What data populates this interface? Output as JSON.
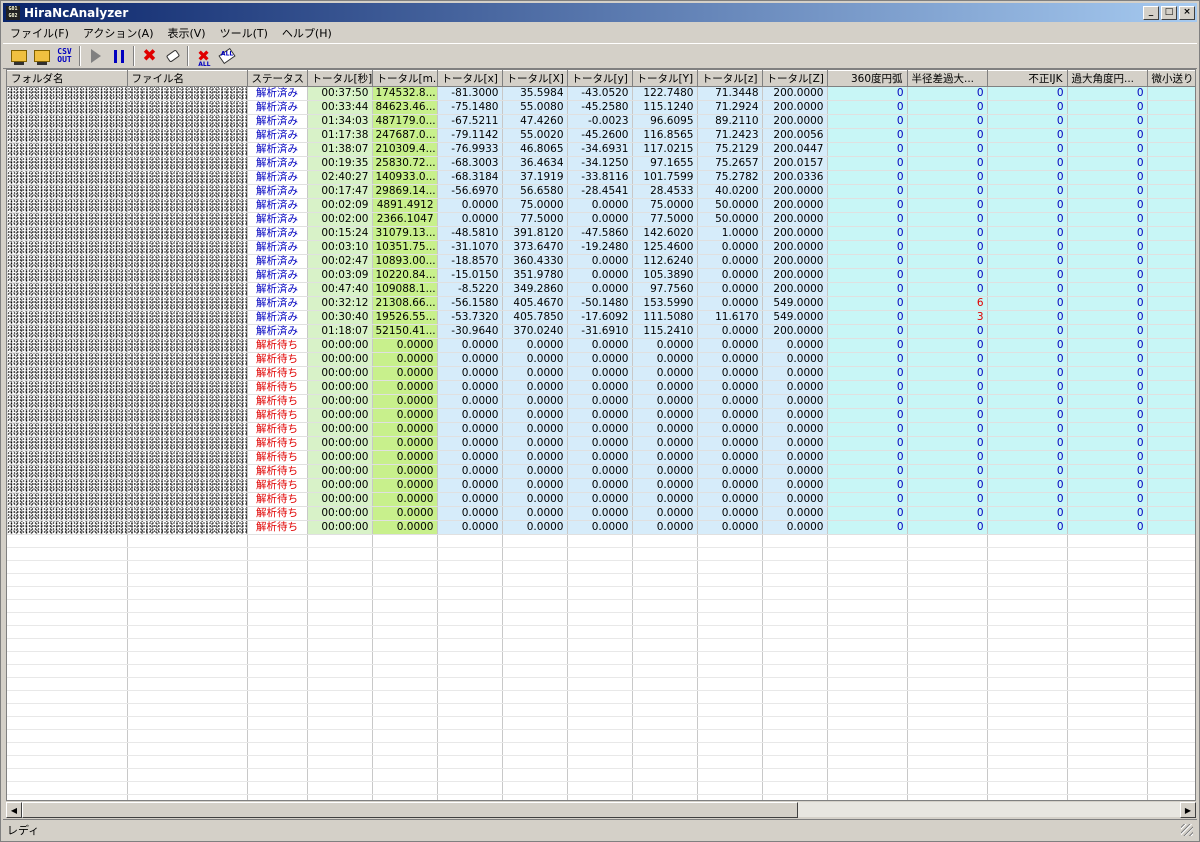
{
  "window": {
    "title": "HiraNcAnalyzer",
    "app_icon_text": "G01 G02"
  },
  "window_buttons": [
    "_",
    "□",
    "×"
  ],
  "menu": [
    "ファイル(F)",
    "アクション(A)",
    "表示(V)",
    "ツール(T)",
    "ヘルプ(H)"
  ],
  "toolbar": {
    "buttons": [
      "open-file-icon",
      "open-folder-icon",
      "csv-out-icon",
      "play-icon",
      "pause-icon",
      "delete-icon",
      "clear-icon",
      "delete-all-icon",
      "clear-all-icon"
    ],
    "csv_label": "CSV OUT",
    "all_label": "ALL"
  },
  "columns": [
    "フォルダ名",
    "ファイル名",
    "ステータス",
    "トータル[秒]",
    "トータル[m...",
    "トータル[x]",
    "トータル[X]",
    "トータル[y]",
    "トータル[Y]",
    "トータル[z]",
    "トータル[Z]",
    "360度円弧",
    "半径差過大...",
    "不正IJK",
    "過大角度円...",
    "微小送り"
  ],
  "rows": [
    [
      "解析済み",
      "00:37:50",
      "174532.8...",
      "-81.3000",
      "35.5984",
      "-43.0520",
      "122.7480",
      "71.3448",
      "200.0000",
      "0",
      "0",
      "0",
      "0"
    ],
    [
      "解析済み",
      "00:33:44",
      "84623.46...",
      "-75.1480",
      "55.0080",
      "-45.2580",
      "115.1240",
      "71.2924",
      "200.0000",
      "0",
      "0",
      "0",
      "0"
    ],
    [
      "解析済み",
      "01:34:03",
      "487179.0...",
      "-67.5211",
      "47.4260",
      "-0.0023",
      "96.6095",
      "89.2110",
      "200.0000",
      "0",
      "0",
      "0",
      "0"
    ],
    [
      "解析済み",
      "01:17:38",
      "247687.0...",
      "-79.1142",
      "55.0020",
      "-45.2600",
      "116.8565",
      "71.2423",
      "200.0056",
      "0",
      "0",
      "0",
      "0"
    ],
    [
      "解析済み",
      "01:38:07",
      "210309.4...",
      "-76.9933",
      "46.8065",
      "-34.6931",
      "117.0215",
      "75.2129",
      "200.0447",
      "0",
      "0",
      "0",
      "0"
    ],
    [
      "解析済み",
      "00:19:35",
      "25830.72...",
      "-68.3003",
      "36.4634",
      "-34.1250",
      "97.1655",
      "75.2657",
      "200.0157",
      "0",
      "0",
      "0",
      "0"
    ],
    [
      "解析済み",
      "02:40:27",
      "140933.0...",
      "-68.3184",
      "37.1919",
      "-33.8116",
      "101.7599",
      "75.2782",
      "200.0336",
      "0",
      "0",
      "0",
      "0"
    ],
    [
      "解析済み",
      "00:17:47",
      "29869.14...",
      "-56.6970",
      "56.6580",
      "-28.4541",
      "28.4533",
      "40.0200",
      "200.0000",
      "0",
      "0",
      "0",
      "0"
    ],
    [
      "解析済み",
      "00:02:09",
      "4891.4912",
      "0.0000",
      "75.0000",
      "0.0000",
      "75.0000",
      "50.0000",
      "200.0000",
      "0",
      "0",
      "0",
      "0"
    ],
    [
      "解析済み",
      "00:02:00",
      "2366.1047",
      "0.0000",
      "77.5000",
      "0.0000",
      "77.5000",
      "50.0000",
      "200.0000",
      "0",
      "0",
      "0",
      "0"
    ],
    [
      "解析済み",
      "00:15:24",
      "31079.13...",
      "-48.5810",
      "391.8120",
      "-47.5860",
      "142.6020",
      "1.0000",
      "200.0000",
      "0",
      "0",
      "0",
      "0"
    ],
    [
      "解析済み",
      "00:03:10",
      "10351.75...",
      "-31.1070",
      "373.6470",
      "-19.2480",
      "125.4600",
      "0.0000",
      "200.0000",
      "0",
      "0",
      "0",
      "0"
    ],
    [
      "解析済み",
      "00:02:47",
      "10893.00...",
      "-18.8570",
      "360.4330",
      "0.0000",
      "112.6240",
      "0.0000",
      "200.0000",
      "0",
      "0",
      "0",
      "0"
    ],
    [
      "解析済み",
      "00:03:09",
      "10220.84...",
      "-15.0150",
      "351.9780",
      "0.0000",
      "105.3890",
      "0.0000",
      "200.0000",
      "0",
      "0",
      "0",
      "0"
    ],
    [
      "解析済み",
      "00:47:40",
      "109088.1...",
      "-8.5220",
      "349.2860",
      "0.0000",
      "97.7560",
      "0.0000",
      "200.0000",
      "0",
      "0",
      "0",
      "0"
    ],
    [
      "解析済み",
      "00:32:12",
      "21308.66...",
      "-56.1580",
      "405.4670",
      "-50.1480",
      "153.5990",
      "0.0000",
      "549.0000",
      "0",
      "6",
      "0",
      "0"
    ],
    [
      "解析済み",
      "00:30:40",
      "19526.55...",
      "-53.7320",
      "405.7850",
      "-17.6092",
      "111.5080",
      "11.6170",
      "549.0000",
      "0",
      "3",
      "0",
      "0"
    ],
    [
      "解析済み",
      "01:18:07",
      "52150.41...",
      "-30.9640",
      "370.0240",
      "-31.6910",
      "115.2410",
      "0.0000",
      "200.0000",
      "0",
      "0",
      "0",
      "0"
    ],
    [
      "解析待ち",
      "00:00:00",
      "0.0000",
      "0.0000",
      "0.0000",
      "0.0000",
      "0.0000",
      "0.0000",
      "0.0000",
      "0",
      "0",
      "0",
      "0"
    ],
    [
      "解析待ち",
      "00:00:00",
      "0.0000",
      "0.0000",
      "0.0000",
      "0.0000",
      "0.0000",
      "0.0000",
      "0.0000",
      "0",
      "0",
      "0",
      "0"
    ],
    [
      "解析待ち",
      "00:00:00",
      "0.0000",
      "0.0000",
      "0.0000",
      "0.0000",
      "0.0000",
      "0.0000",
      "0.0000",
      "0",
      "0",
      "0",
      "0"
    ],
    [
      "解析待ち",
      "00:00:00",
      "0.0000",
      "0.0000",
      "0.0000",
      "0.0000",
      "0.0000",
      "0.0000",
      "0.0000",
      "0",
      "0",
      "0",
      "0"
    ],
    [
      "解析待ち",
      "00:00:00",
      "0.0000",
      "0.0000",
      "0.0000",
      "0.0000",
      "0.0000",
      "0.0000",
      "0.0000",
      "0",
      "0",
      "0",
      "0"
    ],
    [
      "解析待ち",
      "00:00:00",
      "0.0000",
      "0.0000",
      "0.0000",
      "0.0000",
      "0.0000",
      "0.0000",
      "0.0000",
      "0",
      "0",
      "0",
      "0"
    ],
    [
      "解析待ち",
      "00:00:00",
      "0.0000",
      "0.0000",
      "0.0000",
      "0.0000",
      "0.0000",
      "0.0000",
      "0.0000",
      "0",
      "0",
      "0",
      "0"
    ],
    [
      "解析待ち",
      "00:00:00",
      "0.0000",
      "0.0000",
      "0.0000",
      "0.0000",
      "0.0000",
      "0.0000",
      "0.0000",
      "0",
      "0",
      "0",
      "0"
    ],
    [
      "解析待ち",
      "00:00:00",
      "0.0000",
      "0.0000",
      "0.0000",
      "0.0000",
      "0.0000",
      "0.0000",
      "0.0000",
      "0",
      "0",
      "0",
      "0"
    ],
    [
      "解析待ち",
      "00:00:00",
      "0.0000",
      "0.0000",
      "0.0000",
      "0.0000",
      "0.0000",
      "0.0000",
      "0.0000",
      "0",
      "0",
      "0",
      "0"
    ],
    [
      "解析待ち",
      "00:00:00",
      "0.0000",
      "0.0000",
      "0.0000",
      "0.0000",
      "0.0000",
      "0.0000",
      "0.0000",
      "0",
      "0",
      "0",
      "0"
    ],
    [
      "解析待ち",
      "00:00:00",
      "0.0000",
      "0.0000",
      "0.0000",
      "0.0000",
      "0.0000",
      "0.0000",
      "0.0000",
      "0",
      "0",
      "0",
      "0"
    ],
    [
      "解析待ち",
      "00:00:00",
      "0.0000",
      "0.0000",
      "0.0000",
      "0.0000",
      "0.0000",
      "0.0000",
      "0.0000",
      "0",
      "0",
      "0",
      "0"
    ],
    [
      "解析待ち",
      "00:00:00",
      "0.0000",
      "0.0000",
      "0.0000",
      "0.0000",
      "0.0000",
      "0.0000",
      "0.0000",
      "0",
      "0",
      "0",
      "0"
    ]
  ],
  "status_bar": {
    "text": "レディ"
  },
  "colors": {
    "done": "#0000c0",
    "waiting": "#e00000",
    "title_start": "#0a246a",
    "title_end": "#a6caf0"
  }
}
